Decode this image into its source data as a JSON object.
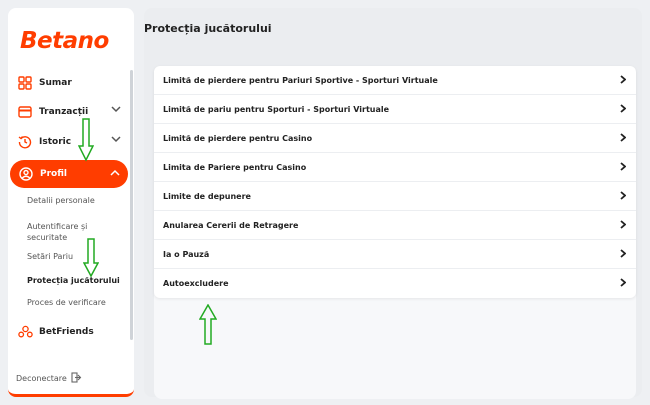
{
  "brand": {
    "logo_text": "Betano",
    "accent": "#ff3d00"
  },
  "sidebar": {
    "items": [
      {
        "label": "Sumar",
        "icon": "grid-icon"
      },
      {
        "label": "Tranzacții",
        "icon": "card-icon"
      },
      {
        "label": "Istoric",
        "icon": "history-icon"
      },
      {
        "label": "Profil",
        "icon": "user-icon"
      },
      {
        "label": "BetFriends",
        "icon": "friends-icon"
      }
    ],
    "profile_sub": [
      {
        "label": "Detalii personale"
      },
      {
        "label": "Autentificare și securitate"
      },
      {
        "label": "Setări Pariu"
      },
      {
        "label": "Protecția jucătorului"
      },
      {
        "label": "Proces de verificare"
      }
    ],
    "logout_label": "Deconectare"
  },
  "main": {
    "title": "Protecția jucătorului",
    "rows": [
      {
        "label": "Limită de pierdere pentru Pariuri Sportive - Sporturi Virtuale"
      },
      {
        "label": "Limită de pariu pentru Sporturi - Sporturi Virtuale"
      },
      {
        "label": "Limită de pierdere pentru Casino"
      },
      {
        "label": "Limita de Pariere pentru Casino"
      },
      {
        "label": "Limite de depunere"
      },
      {
        "label": "Anularea Cererii de Retragere"
      },
      {
        "label": "Ia o Pauză"
      },
      {
        "label": "Autoexcludere"
      }
    ]
  }
}
